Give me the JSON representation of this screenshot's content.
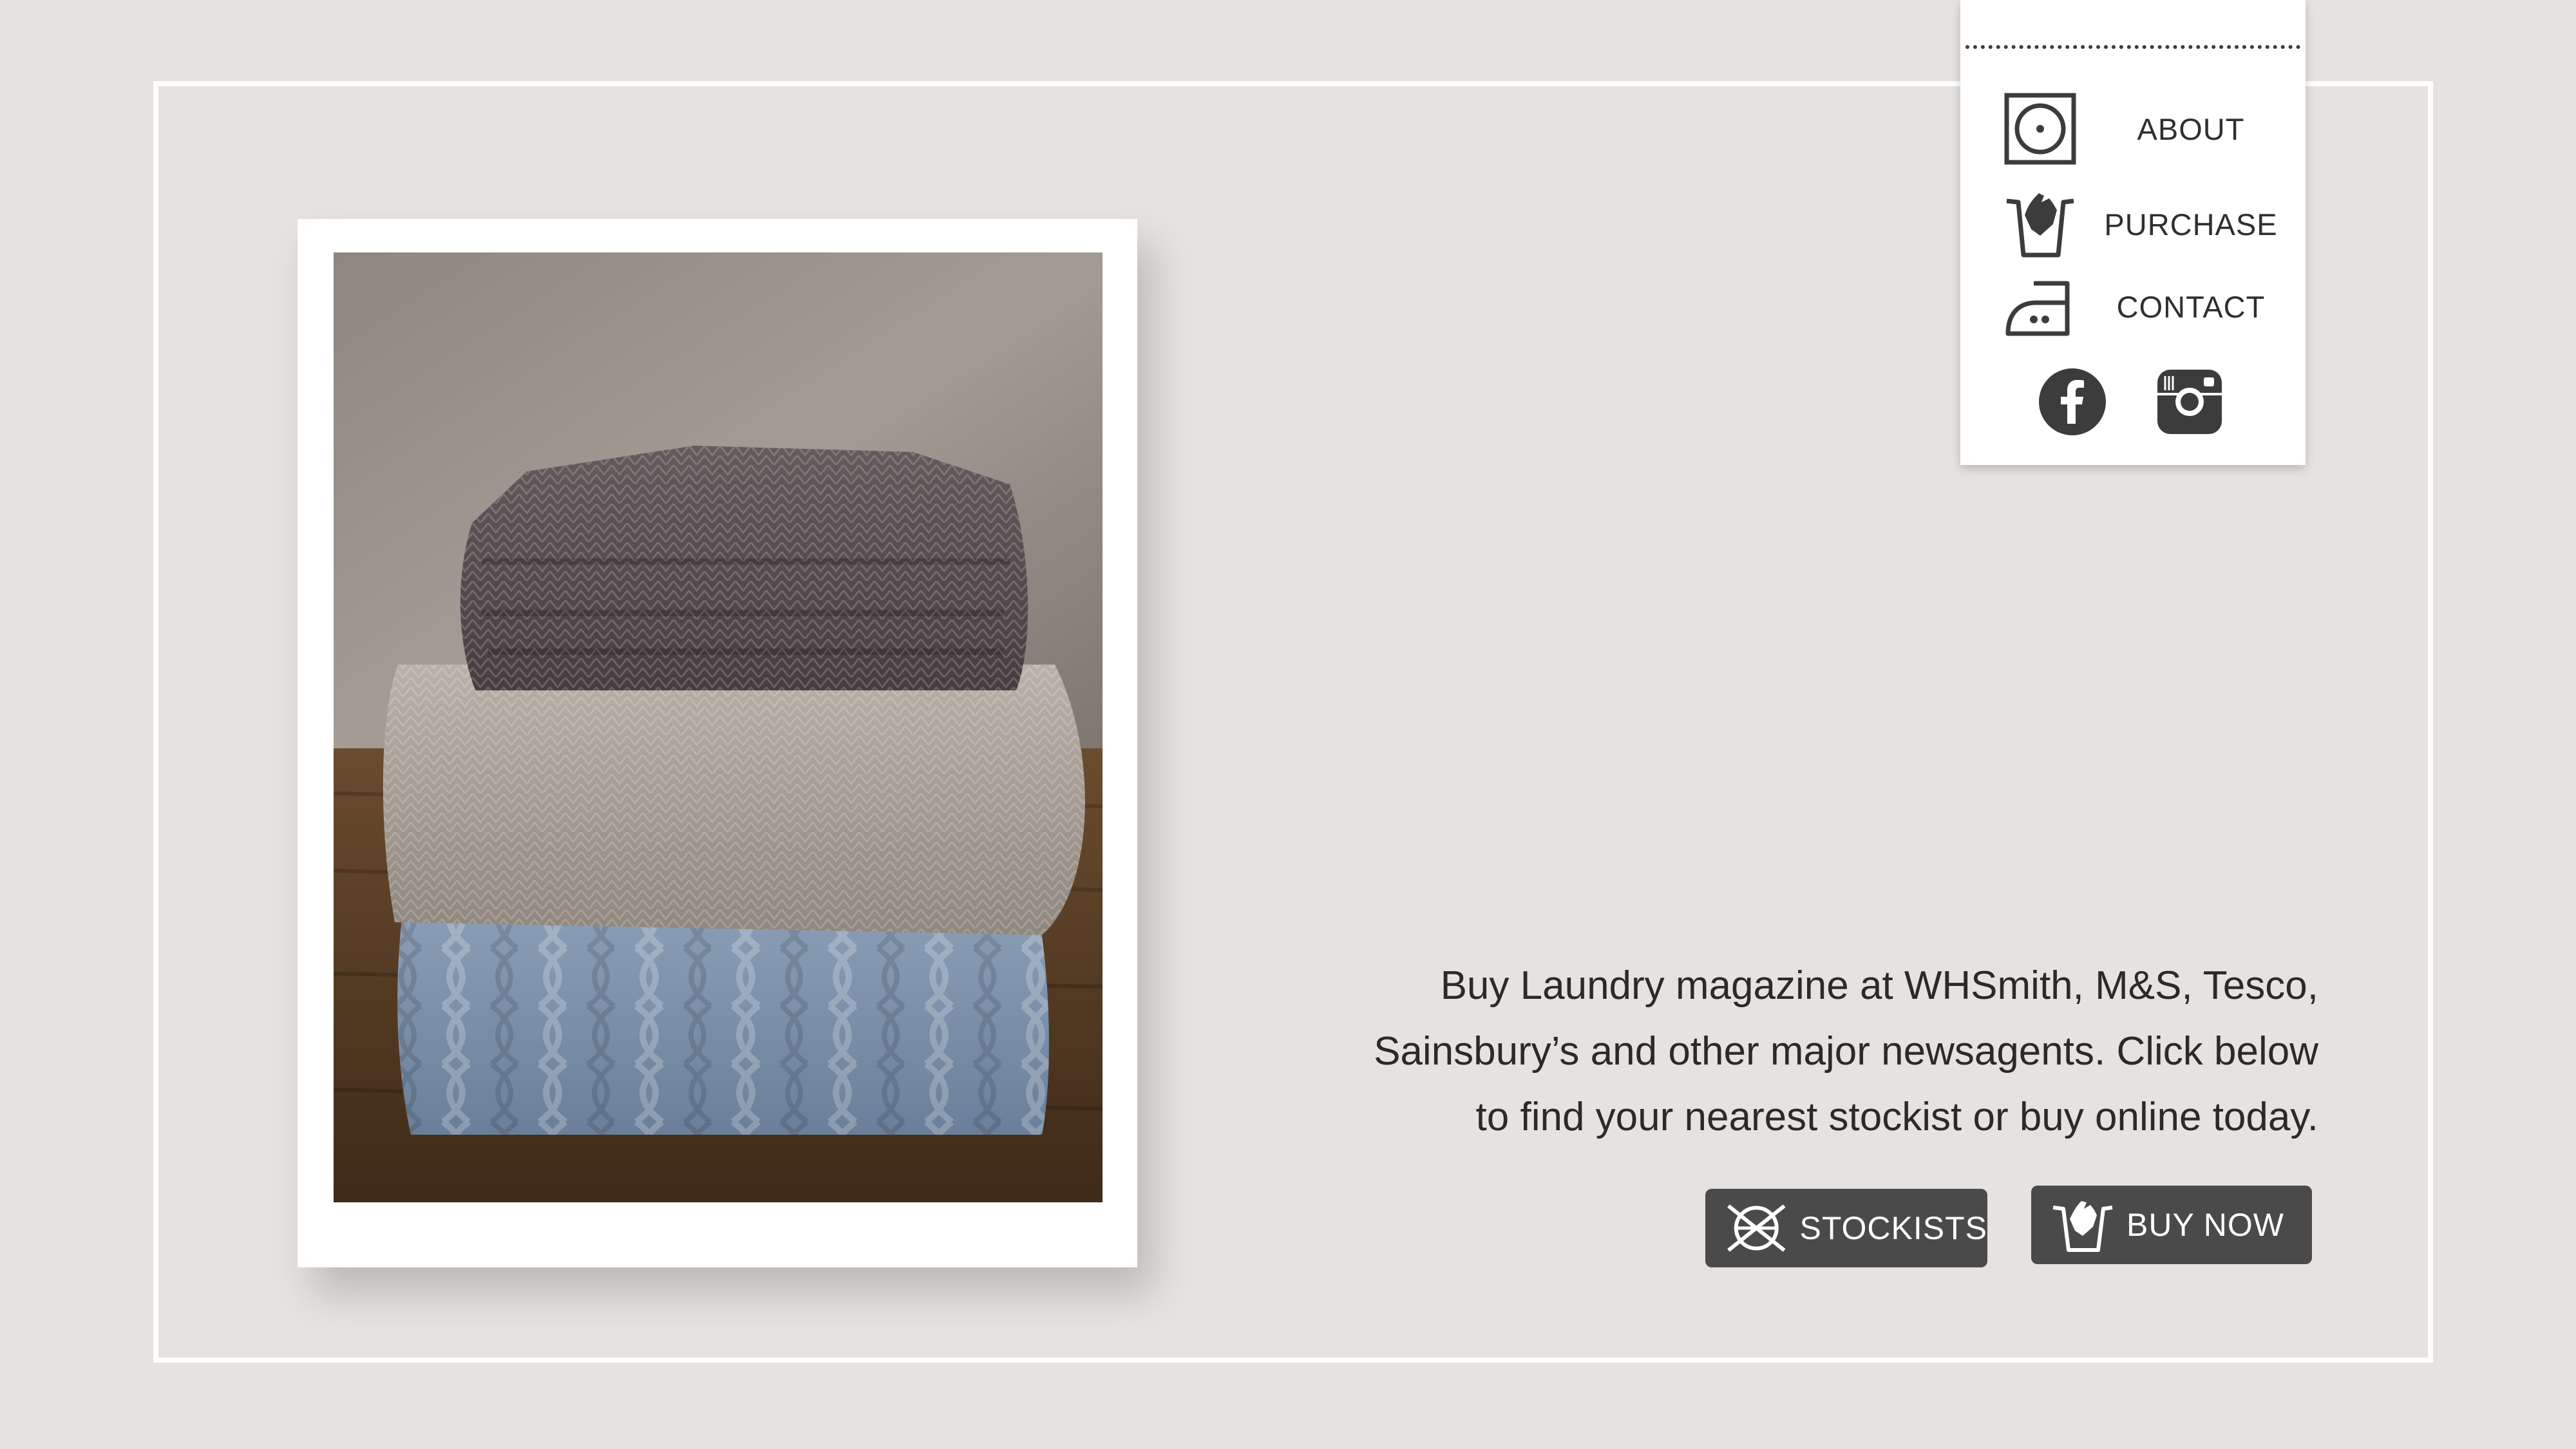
{
  "nav": {
    "items": [
      {
        "label": "ABOUT",
        "icon": "dryer-icon"
      },
      {
        "label": "PURCHASE",
        "icon": "handwash-icon"
      },
      {
        "label": "CONTACT",
        "icon": "iron-icon"
      }
    ],
    "social": [
      {
        "icon": "facebook-icon"
      },
      {
        "icon": "instagram-icon"
      }
    ]
  },
  "hero": {
    "image": "folded-knit-sweaters-photo",
    "lines": [
      "Buy Laundry magazine at WHSmith, M&S, Tesco,",
      "Sainsbury’s and other major newsagents. Click below",
      "to find your nearest stockist or buy online today."
    ]
  },
  "buttons": {
    "stockists": {
      "label": "STOCKISTS",
      "icon": "do-not-dryclean-icon"
    },
    "buy_now": {
      "label": "BUY NOW",
      "icon": "handwash-icon"
    }
  },
  "colors": {
    "background": "#e6e2e0",
    "button": "#4a4a4a",
    "icon": "#3c3c3c"
  }
}
